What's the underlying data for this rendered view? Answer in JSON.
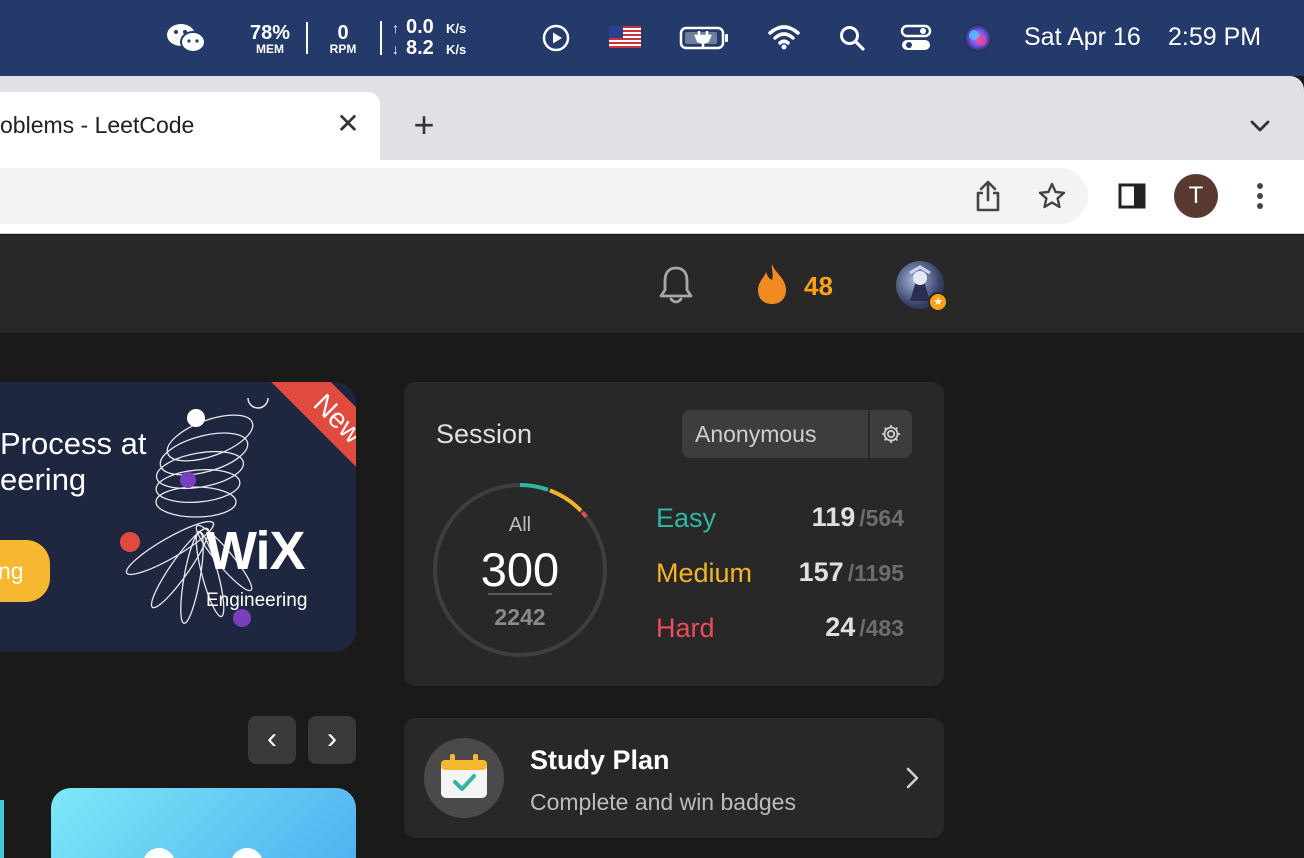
{
  "menubar": {
    "mem_value": "78%",
    "mem_label": "MEM",
    "rpm_value": "0",
    "rpm_label": "RPM",
    "net_up_arrow": "↑",
    "net_up": "0.0",
    "net_up_unit": "K/s",
    "net_down_arrow": "↓",
    "net_down": "8.2",
    "net_down_unit": "K/s",
    "date": "Sat Apr 16",
    "time": "2:59 PM",
    "icons": [
      "wechat-icon",
      "play-icon",
      "us-flag-icon",
      "battery-charging-icon",
      "wifi-icon",
      "search-icon",
      "control-center-icon",
      "siri-icon"
    ]
  },
  "browser": {
    "tab_title": "oblems - LeetCode",
    "tab_close": "✕",
    "new_tab": "+",
    "profile_initial": "T",
    "icons": [
      "share-icon",
      "star-icon",
      "side-panel-icon",
      "more-menu-icon",
      "tab-list-chevron-icon"
    ]
  },
  "leetcode_nav": {
    "streak_count": "48",
    "icons": [
      "bell-icon",
      "fire-icon",
      "avatar",
      "avatar-star-badge-icon"
    ],
    "colors": {
      "streak": "#ffa116"
    }
  },
  "banner": {
    "line1": "Process at",
    "line2": "eering",
    "cta": "ng",
    "ribbon": "New",
    "wix_word": "WiX",
    "wix_sub": "Engineering",
    "prev": "‹",
    "next": "›"
  },
  "session": {
    "title": "Session",
    "selector_value": "Anonymous",
    "ring_label": "All",
    "solved": "300",
    "total": "2242",
    "difficulties": [
      {
        "label": "Easy",
        "solved": "119",
        "total": "/564",
        "color": "#2db7a6"
      },
      {
        "label": "Medium",
        "solved": "157",
        "total": "/1195",
        "color": "#f5b428"
      },
      {
        "label": "Hard",
        "solved": "24",
        "total": "/483",
        "color": "#ec4b5b"
      }
    ]
  },
  "study_plan": {
    "title": "Study Plan",
    "subtitle": "Complete and win badges"
  }
}
